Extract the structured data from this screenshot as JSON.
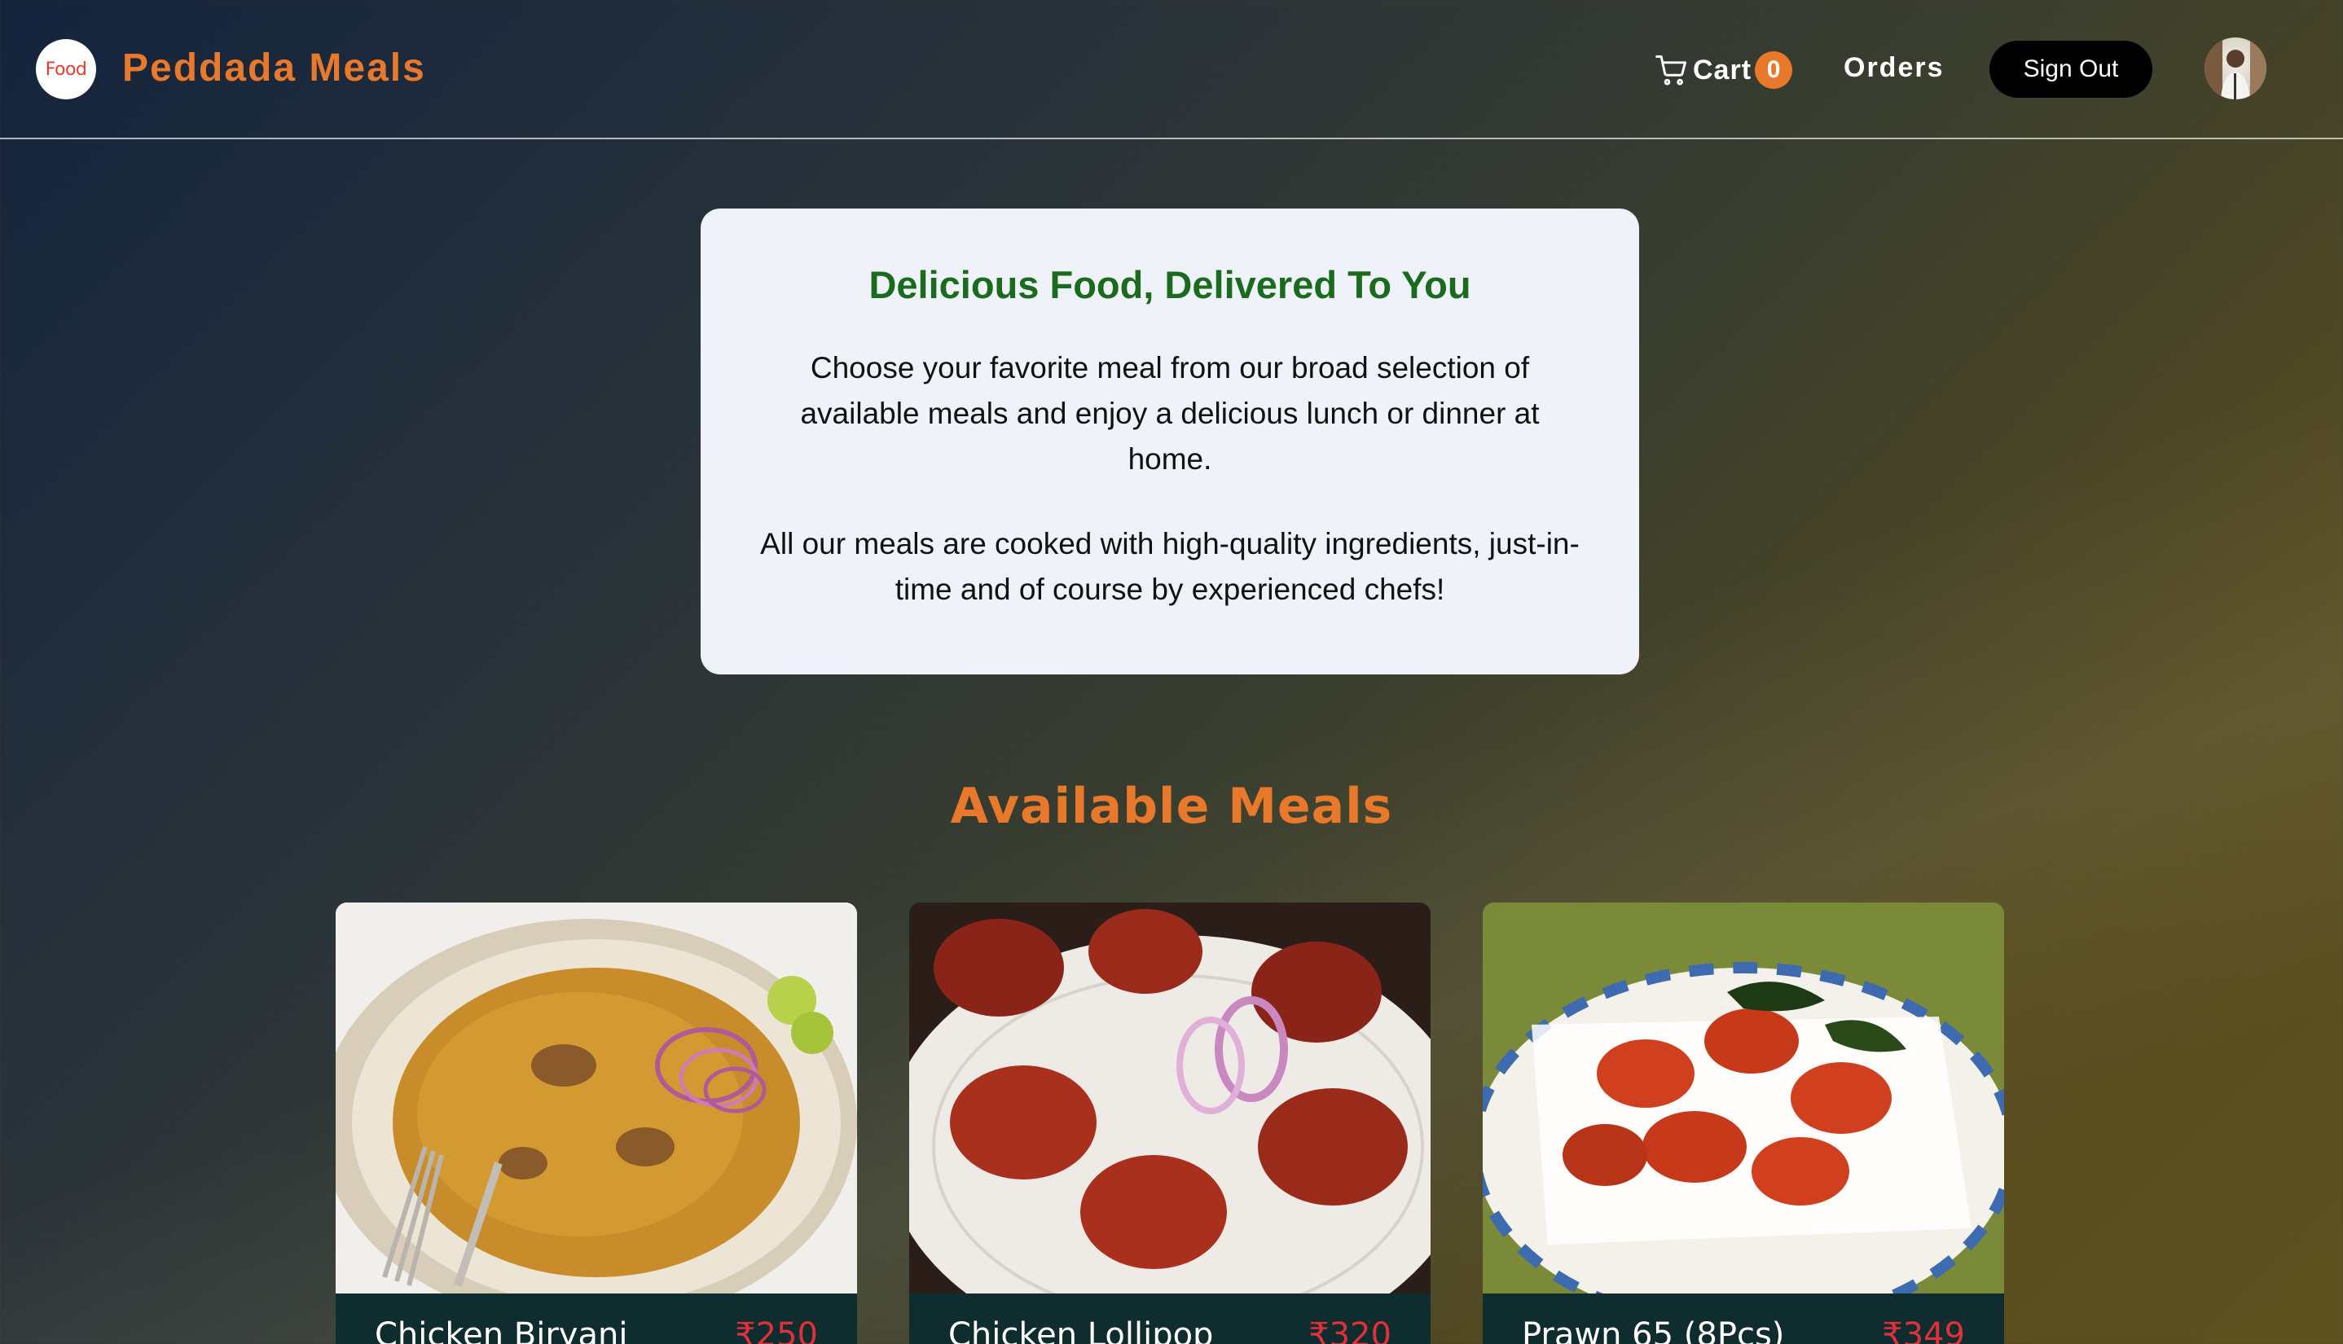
{
  "header": {
    "logo_text": "Food",
    "brand": "Peddada Meals",
    "cart_label": "Cart",
    "cart_count": "0",
    "orders_label": "Orders",
    "signout_label": "Sign Out"
  },
  "intro": {
    "title": "Delicious Food, Delivered To You",
    "paragraph1": "Choose your favorite meal from our broad selection of available meals and enjoy a delicious lunch or dinner at home.",
    "paragraph2": "All our meals are cooked with high-quality ingredients, just-in-time and of course by experienced chefs!"
  },
  "meals_section": {
    "title": "Available Meals",
    "items": [
      {
        "name": "Chicken Biryani",
        "price": "₹250"
      },
      {
        "name": "Chicken Lollipop",
        "price": "₹320"
      },
      {
        "name": "Prawn 65 (8Pcs)",
        "price": "₹349"
      }
    ]
  },
  "colors": {
    "accent": "#e8782a",
    "title_green": "#1a6b1d",
    "price_red": "#e0303a",
    "card_footer": "#0f2d2e"
  }
}
